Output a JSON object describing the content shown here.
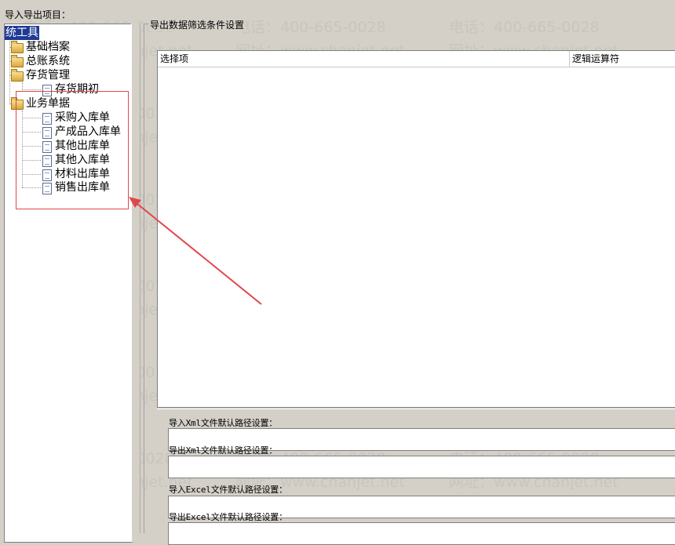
{
  "top_label": "导入导出项目：",
  "tree": {
    "root": "统工具",
    "nodes": {
      "basic": "基础档案",
      "gl": "总账系统",
      "inventory": "存货管理",
      "inventory_opening": "存货期初",
      "business": "业务单据",
      "purchase_in": "采购入库单",
      "product_in": "产成品入库单",
      "other_out": "其他出库单",
      "other_in": "其他入库单",
      "material_out": "材料出库单",
      "sales_out": "销售出库单"
    }
  },
  "filter_group": {
    "title": "导出数据筛选条件设置",
    "columns": [
      "选择项",
      "逻辑运算符"
    ]
  },
  "paths": {
    "import_xml": "导入Xml文件默认路径设置：",
    "export_xml": "导出Xml文件默认路径设置：",
    "import_excel": "导入Excel文件默认路径设置：",
    "export_excel": "导出Excel文件默认路径设置："
  },
  "watermark": {
    "phone": "电话：400-665-0028",
    "site": "网址：www.chanjet.net"
  },
  "colors": {
    "highlight": "#e0474c",
    "selection": "#1f3a93"
  }
}
